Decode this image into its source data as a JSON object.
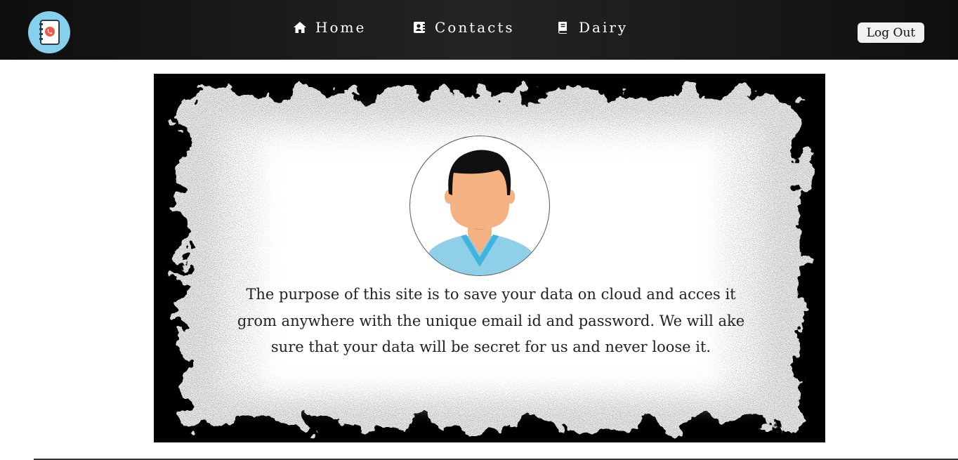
{
  "navbar": {
    "logo_icon": "phonebook-icon",
    "links": [
      {
        "label": "Home",
        "icon": "home-icon"
      },
      {
        "label": "Contacts",
        "icon": "contact-card-icon"
      },
      {
        "label": "Dairy",
        "icon": "book-icon"
      }
    ],
    "logout_label": "Log Out",
    "background": "#1a1a1a",
    "logo_color": "#86d0ec"
  },
  "hero": {
    "avatar_icon": "user-avatar-icon",
    "text": "The purpose of this site is to save your data on cloud and acces it grom anywhere with the unique email id and password. We will ake sure that your data will be secret for us and never loose it."
  }
}
